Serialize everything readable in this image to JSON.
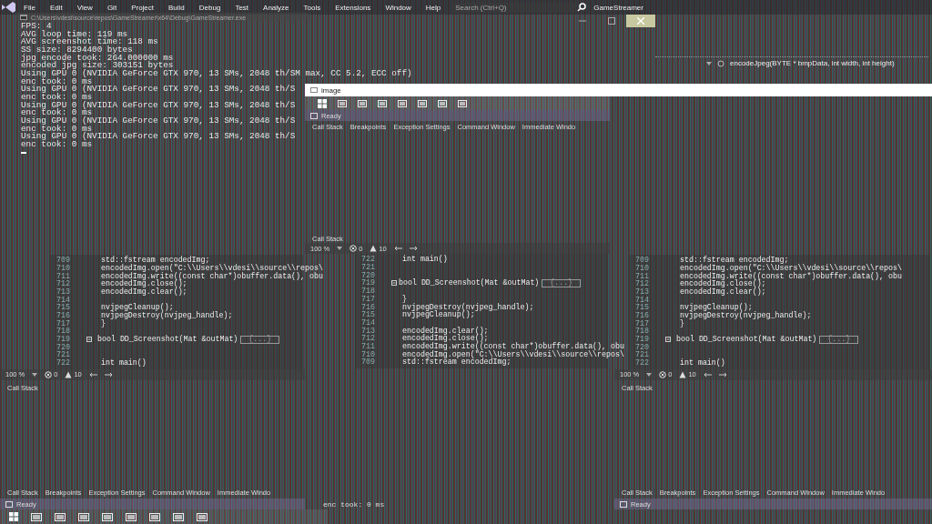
{
  "menu_bar": {
    "items": [
      "File",
      "Edit",
      "View",
      "Git",
      "Project",
      "Build",
      "Debug",
      "Test",
      "Analyze",
      "Tools",
      "Extensions",
      "Window",
      "Help"
    ],
    "search": {
      "placeholder": "Search (Ctrl+Q)"
    },
    "solution_name": "GameStreamer"
  },
  "console": {
    "title": "C:\\Users\\vdesi\\source\\repos\\GameStreamer\\x64\\Debug\\GameStreamer.exe",
    "lines": [
      "FPS: 4",
      "AVG loop time: 119 ms",
      "AVG screenshot time: 118 ms",
      "SS size: 8294400 bytes",
      "jpg encode took: 264.000000 ms",
      "encoded jpg size: 303151 bytes",
      "Using GPU 0 (NVIDIA GeForce GTX 970, 13 SMs, 2048 th/SM max, CC 5.2, ECC off)",
      "enc took: 0 ms",
      "Using GPU 0 (NVIDIA GeForce GTX 970, 13 SMs, 2048 th/S",
      "enc took: 0 ms",
      "Using GPU 0 (NVIDIA GeForce GTX 970, 13 SMs, 2048 th/S",
      "enc took: 0 ms",
      "Using GPU 0 (NVIDIA GeForce GTX 970, 13 SMs, 2048 th/S",
      "enc took: 0 ms",
      "Using GPU 0 (NVIDIA GeForce GTX 970, 13 SMs, 2048 th/S",
      "enc took: 0 ms"
    ]
  },
  "navigation_bar": {
    "member": "encodeJpeg(BYTE * bmpData, int width, int height)"
  },
  "image_window": {
    "title": "image",
    "mirrored_console_line": "enc took: 0 ms"
  },
  "panels": [
    {
      "kind": "normal",
      "code": [
        {
          "number": "709",
          "text": "std::fstream encodedImg;"
        },
        {
          "number": "710",
          "text": "encodedImg.open(\"C:\\\\Users\\\\vdesi\\\\source\\\\repos\\"
        },
        {
          "number": "711",
          "text": "encodedImg.write((const char*)obuffer.data(), obu"
        },
        {
          "number": "712",
          "text": "encodedImg.close();"
        },
        {
          "number": "713",
          "text": "encodedImg.clear();"
        },
        {
          "number": "714"
        },
        {
          "number": "715",
          "text": "nvjpegCleanup();"
        },
        {
          "number": "716",
          "text": "nvjpegDestroy(nvjpeg_handle);"
        },
        {
          "number": "717",
          "text": "}"
        },
        {
          "number": "718"
        },
        {
          "number": "719",
          "text": "bool DD_Screenshot(Mat &outMat)",
          "collapsed": "{...}"
        },
        {
          "number": "720"
        },
        {
          "number": "721"
        },
        {
          "number": "722",
          "text": "int main()"
        }
      ],
      "zoom": "100 %",
      "errors": "0",
      "warnings": "10",
      "call_stack_title": "Call Stack",
      "tabs": [
        "Call Stack",
        "Breakpoints",
        "Exception Settings",
        "Command Window",
        "Immediate Windo"
      ],
      "status": "Ready"
    },
    {
      "kind": "mirrored",
      "code": [
        {
          "number": "722",
          "text": "int main()"
        },
        {
          "number": "721"
        },
        {
          "number": "720"
        },
        {
          "number": "719",
          "text": "bool DD_Screenshot(Mat &outMat)",
          "collapsed": "{...}"
        },
        {
          "number": "718"
        },
        {
          "number": "717",
          "text": "}"
        },
        {
          "number": "716",
          "text": "nvjpegDestroy(nvjpeg_handle);"
        },
        {
          "number": "715",
          "text": "nvjpegCleanup();"
        },
        {
          "number": "714"
        },
        {
          "number": "713",
          "text": "encodedImg.clear();"
        },
        {
          "number": "712",
          "text": "encodedImg.close();"
        },
        {
          "number": "711",
          "text": "encodedImg.write((const char*)obuffer.data(), obu"
        },
        {
          "number": "710",
          "text": "encodedImg.open(\"C:\\\\Users\\\\vdesi\\\\source\\\\repos\\"
        },
        {
          "number": "709",
          "text": "std::fstream encodedImg;"
        }
      ],
      "zoom": "100 %",
      "errors": "0",
      "warnings": "10",
      "call_stack_title": "Call Stack",
      "tabs": [
        "Call Stack",
        "Breakpoints",
        "Exception Settings",
        "Command Window",
        "Immediate Windo"
      ],
      "status": "Ready"
    },
    {
      "kind": "normal",
      "code": [
        {
          "number": "709",
          "text": "std::fstream encodedImg;"
        },
        {
          "number": "710",
          "text": "encodedImg.open(\"C:\\\\Users\\\\vdesi\\\\source\\\\repos\\"
        },
        {
          "number": "711",
          "text": "encodedImg.write((const char*)obuffer.data(), obu"
        },
        {
          "number": "712",
          "text": "encodedImg.close();"
        },
        {
          "number": "713",
          "text": "encodedImg.clear();"
        },
        {
          "number": "714"
        },
        {
          "number": "715",
          "text": "nvjpegCleanup();"
        },
        {
          "number": "716",
          "text": "nvjpegDestroy(nvjpeg_handle);"
        },
        {
          "number": "717",
          "text": "}"
        },
        {
          "number": "718"
        },
        {
          "number": "719",
          "text": "bool DD_Screenshot(Mat &outMat)",
          "collapsed": "{...}"
        },
        {
          "number": "720"
        },
        {
          "number": "721"
        },
        {
          "number": "722",
          "text": "int main()"
        }
      ],
      "zoom": "100 %",
      "errors": "0",
      "warnings": "10",
      "call_stack_title": "Call Stack",
      "tabs": [
        "Call Stack",
        "Breakpoints",
        "Exception Settings",
        "Command Window",
        "Immediate Windo"
      ],
      "status": "Ready"
    }
  ]
}
